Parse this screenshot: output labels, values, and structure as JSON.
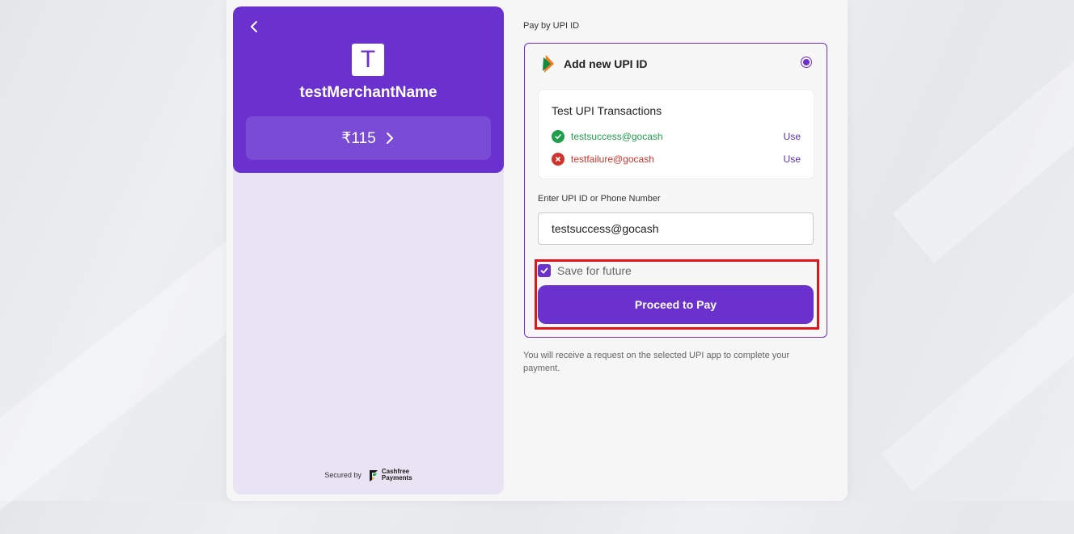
{
  "merchant": {
    "logo_letter": "T",
    "name": "testMerchantName",
    "amount": "₹115"
  },
  "footer": {
    "secured_by": "Secured by",
    "brand_line1": "Cashfree",
    "brand_line2": "Payments"
  },
  "upi": {
    "section_title": "Pay by UPI ID",
    "option_title": "Add new UPI ID",
    "option_selected": true,
    "test_title": "Test UPI Transactions",
    "test_ids": [
      {
        "vpa": "testsuccess@gocash",
        "action": "Use",
        "status": "success",
        "color": "#1e9e4a"
      },
      {
        "vpa": "testfailure@gocash",
        "action": "Use",
        "status": "failure",
        "color": "#d0342c"
      }
    ],
    "input_label": "Enter UPI ID or Phone Number",
    "input_value": "testsuccess@gocash",
    "save_label": "Save for future",
    "save_checked": true,
    "pay_label": "Proceed to Pay",
    "note": "You will receive a request on the selected UPI app to complete your payment."
  },
  "colors": {
    "brand": "#6a31cf",
    "amount_button": "#7a4bd4",
    "left_panel_bg": "#e8e4f4",
    "highlight": "#e0141b"
  }
}
